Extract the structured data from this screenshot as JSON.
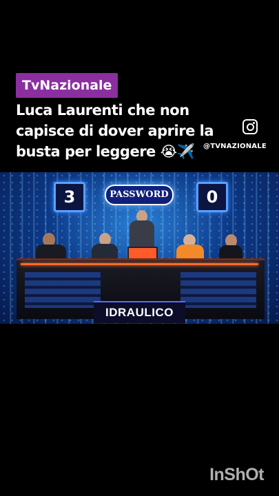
{
  "badge": "TvNazionale",
  "caption": {
    "line1": "Luca Laurenti che non",
    "line2": "capisce di dover aprire la",
    "line3": "busta per leggere 😭✈️"
  },
  "instagram": {
    "handle": "@TVNAZIONALE",
    "icon": "instagram-icon"
  },
  "game": {
    "score_left": "3",
    "score_right": "0",
    "logo_text": "PASSWORD",
    "word": "IDRAULICO"
  },
  "watermark": "InShOt",
  "colors": {
    "badge": "#8b2fa0",
    "podium": "#ff5a2a",
    "accent_blue": "#2a7fd6"
  }
}
